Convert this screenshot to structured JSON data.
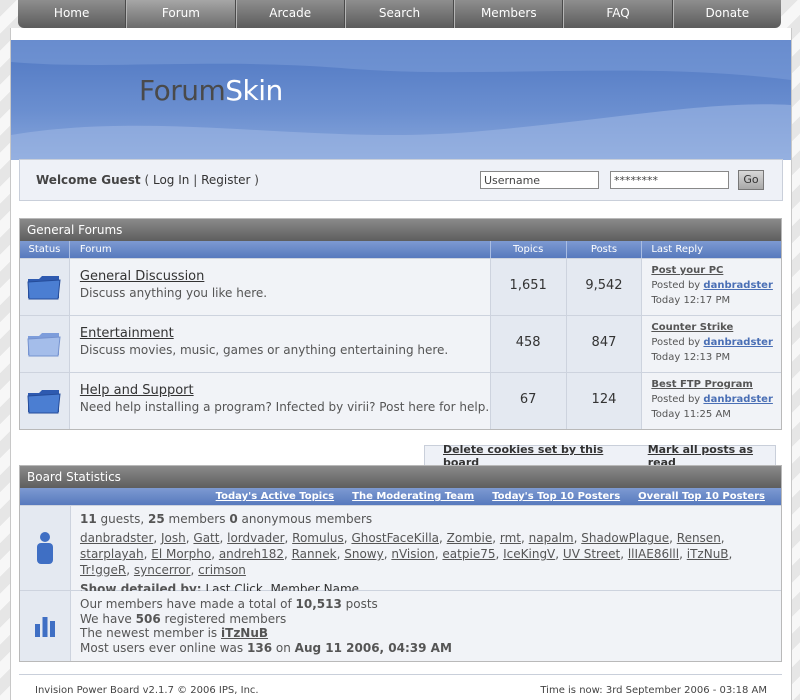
{
  "nav": [
    "Home",
    "Forum",
    "Arcade",
    "Search",
    "Members",
    "FAQ",
    "Donate"
  ],
  "logo": {
    "part1": "Forum",
    "part2": "Skin"
  },
  "login": {
    "welcome": "Welcome Guest",
    "open": "( ",
    "login": "Log In",
    "divider": " | ",
    "register": "Register",
    "close": " )",
    "username_value": "Username",
    "password_value": "********",
    "go": "Go"
  },
  "general": {
    "title": "General Forums",
    "columns": [
      "Status",
      "Forum",
      "Topics",
      "Posts",
      "Last Reply"
    ],
    "forums": [
      {
        "name": "General Discussion",
        "desc": "Discuss anything you like here.",
        "topics": "1,651",
        "posts": "9,542",
        "last_title": "Post your PC",
        "posted_by": "Posted by",
        "last_user": "danbradster",
        "last_time": "Today 12:17 PM"
      },
      {
        "name": "Entertainment",
        "desc": "Discuss movies, music, games or anything entertaining here.",
        "topics": "458",
        "posts": "847",
        "last_title": "Counter Strike",
        "posted_by": "Posted by",
        "last_user": "danbradster",
        "last_time": "Today 12:13 PM"
      },
      {
        "name": "Help and Support",
        "desc": "Need help installing a program?  Infected by virii?  Post here for help.",
        "topics": "67",
        "posts": "124",
        "last_title": "Best FTP Program",
        "posted_by": "Posted by",
        "last_user": "danbradster",
        "last_time": "Today 11:25 AM"
      }
    ]
  },
  "board_links": {
    "delete_cookies": "Delete cookies set by this board",
    "mark_read": "Mark all posts as read"
  },
  "stats": {
    "title": "Board Statistics",
    "links": [
      "Today's Active Topics",
      "The Moderating Team",
      "Today's Top 10 Posters",
      "Overall Top 10 Posters"
    ],
    "online": {
      "guests": "11",
      "guests_label": "guests,",
      "members": "25",
      "members_label": "members",
      "anon": "0",
      "anon_label": "anonymous members",
      "users": [
        "danbradster",
        "Josh",
        "Gatt",
        "lordvader",
        "Romulus",
        "GhostFaceKilla",
        "Zombie",
        "rmt",
        "napalm",
        "ShadowPlague",
        "Rensen",
        "starplayah",
        "El Morpho",
        "andreh182",
        "Rannek",
        "Snowy",
        "nVision",
        "eatpie75",
        "IceKingV",
        "UV Street",
        "llIAE86lll",
        "iTzNuB",
        "Tr!ggeR",
        "syncerror",
        "crimson"
      ],
      "show_label": "Show detailed by:",
      "show_options": [
        "Last Click",
        "Member Name"
      ]
    },
    "totals": {
      "line1_pre": "Our members have made a total of",
      "posts_total": "10,513",
      "line1_post": "posts",
      "line2_pre": "We have",
      "members_total": "506",
      "line2_post": "registered members",
      "line3_pre": "The newest member is",
      "newest": "iTzNuB",
      "line4_pre": "Most users ever online was",
      "max_online": "136",
      "line4_mid": "on",
      "max_date": "Aug 11 2006, 04:39 AM"
    }
  },
  "footer": {
    "left": "Invision Power Board  v2.1.7 © 2006  IPS, Inc.",
    "right": "Time is now: 3rd September 2006 - 03:18 AM"
  },
  "colors": {
    "accent_blue": "#5779bd",
    "header_gray": "#6e6e6e",
    "folder_blue": "#3f6fc4"
  }
}
